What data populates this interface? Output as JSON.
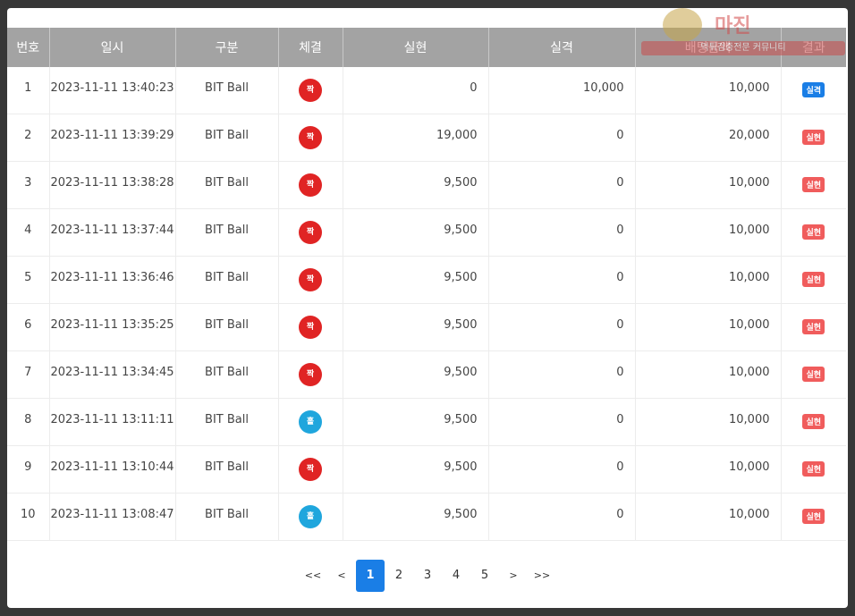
{
  "headers": [
    "번호",
    "일시",
    "구분",
    "체결",
    "실현",
    "실격",
    "배팅금액",
    "결과"
  ],
  "watermark": {
    "title": "마진",
    "subtitle": "먹튀검증전문 커뮤니티"
  },
  "colors": {
    "red_circle": "#e02424",
    "blue_circle": "#1fa6dd",
    "badge_win": "#f05c5c",
    "badge_lose": "#1a7ee6",
    "pager_active": "#1a7ee6"
  },
  "rows": [
    {
      "no": "1",
      "datetime": "2023-11-11 13:40:23",
      "type": "BIT Ball",
      "bet": "짝",
      "bet_color": "red",
      "realized": "0",
      "lost": "10,000",
      "amount": "10,000",
      "result": "실격",
      "result_kind": "lose"
    },
    {
      "no": "2",
      "datetime": "2023-11-11 13:39:29",
      "type": "BIT Ball",
      "bet": "짝",
      "bet_color": "red",
      "realized": "19,000",
      "lost": "0",
      "amount": "20,000",
      "result": "실현",
      "result_kind": "win"
    },
    {
      "no": "3",
      "datetime": "2023-11-11 13:38:28",
      "type": "BIT Ball",
      "bet": "짝",
      "bet_color": "red",
      "realized": "9,500",
      "lost": "0",
      "amount": "10,000",
      "result": "실현",
      "result_kind": "win"
    },
    {
      "no": "4",
      "datetime": "2023-11-11 13:37:44",
      "type": "BIT Ball",
      "bet": "짝",
      "bet_color": "red",
      "realized": "9,500",
      "lost": "0",
      "amount": "10,000",
      "result": "실현",
      "result_kind": "win"
    },
    {
      "no": "5",
      "datetime": "2023-11-11 13:36:46",
      "type": "BIT Ball",
      "bet": "짝",
      "bet_color": "red",
      "realized": "9,500",
      "lost": "0",
      "amount": "10,000",
      "result": "실현",
      "result_kind": "win"
    },
    {
      "no": "6",
      "datetime": "2023-11-11 13:35:25",
      "type": "BIT Ball",
      "bet": "짝",
      "bet_color": "red",
      "realized": "9,500",
      "lost": "0",
      "amount": "10,000",
      "result": "실현",
      "result_kind": "win"
    },
    {
      "no": "7",
      "datetime": "2023-11-11 13:34:45",
      "type": "BIT Ball",
      "bet": "짝",
      "bet_color": "red",
      "realized": "9,500",
      "lost": "0",
      "amount": "10,000",
      "result": "실현",
      "result_kind": "win"
    },
    {
      "no": "8",
      "datetime": "2023-11-11 13:11:11",
      "type": "BIT Ball",
      "bet": "홀",
      "bet_color": "blue",
      "realized": "9,500",
      "lost": "0",
      "amount": "10,000",
      "result": "실현",
      "result_kind": "win"
    },
    {
      "no": "9",
      "datetime": "2023-11-11 13:10:44",
      "type": "BIT Ball",
      "bet": "짝",
      "bet_color": "red",
      "realized": "9,500",
      "lost": "0",
      "amount": "10,000",
      "result": "실현",
      "result_kind": "win"
    },
    {
      "no": "10",
      "datetime": "2023-11-11 13:08:47",
      "type": "BIT Ball",
      "bet": "홀",
      "bet_color": "blue",
      "realized": "9,500",
      "lost": "0",
      "amount": "10,000",
      "result": "실현",
      "result_kind": "win"
    }
  ],
  "pagination": {
    "first": "<<",
    "prev": "<",
    "pages": [
      "1",
      "2",
      "3",
      "4",
      "5"
    ],
    "active": "1",
    "next": ">",
    "last": ">>"
  }
}
